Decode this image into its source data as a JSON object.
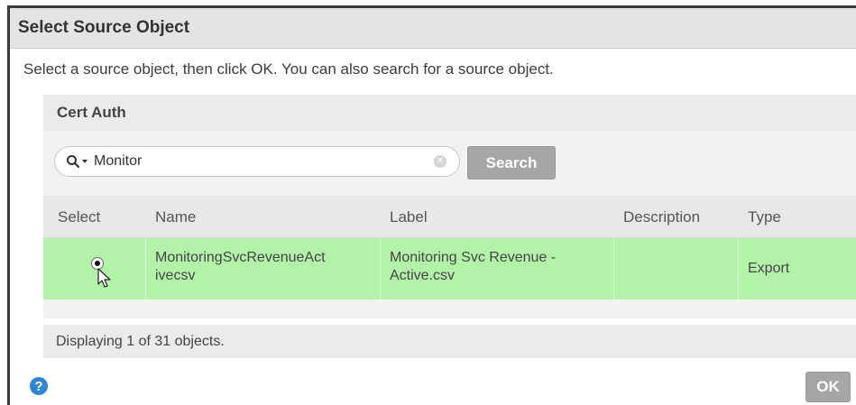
{
  "dialog": {
    "title": "Select Source Object",
    "instructions": "Select a source object, then click OK. You can also search for a source object."
  },
  "panel": {
    "title": "Cert Auth",
    "search": {
      "value": "Monitor",
      "placeholder": "",
      "button_label": "Search"
    },
    "table": {
      "columns": [
        "Select",
        "Name",
        "Label",
        "Description",
        "Type"
      ],
      "rows": [
        {
          "selected": true,
          "name_line1": "MonitoringSvcRevenueAct",
          "name_line2": "ivecsv",
          "label_line1": "Monitoring Svc Revenue -",
          "label_line2": "Active.csv",
          "description": "",
          "type": "Export"
        }
      ]
    },
    "status": "Displaying 1 of 31 objects."
  },
  "footer": {
    "help_glyph": "?",
    "ok_label": "OK"
  },
  "icons": {
    "search": "search-icon",
    "dropdown": "chevron-down-icon",
    "clear": "clear-icon",
    "help": "help-icon",
    "cursor": "mouse-pointer-icon"
  },
  "colors": {
    "selected_row": "#b3f2a9",
    "button_disabled": "#a6a6a6",
    "help": "#2b86d6"
  }
}
